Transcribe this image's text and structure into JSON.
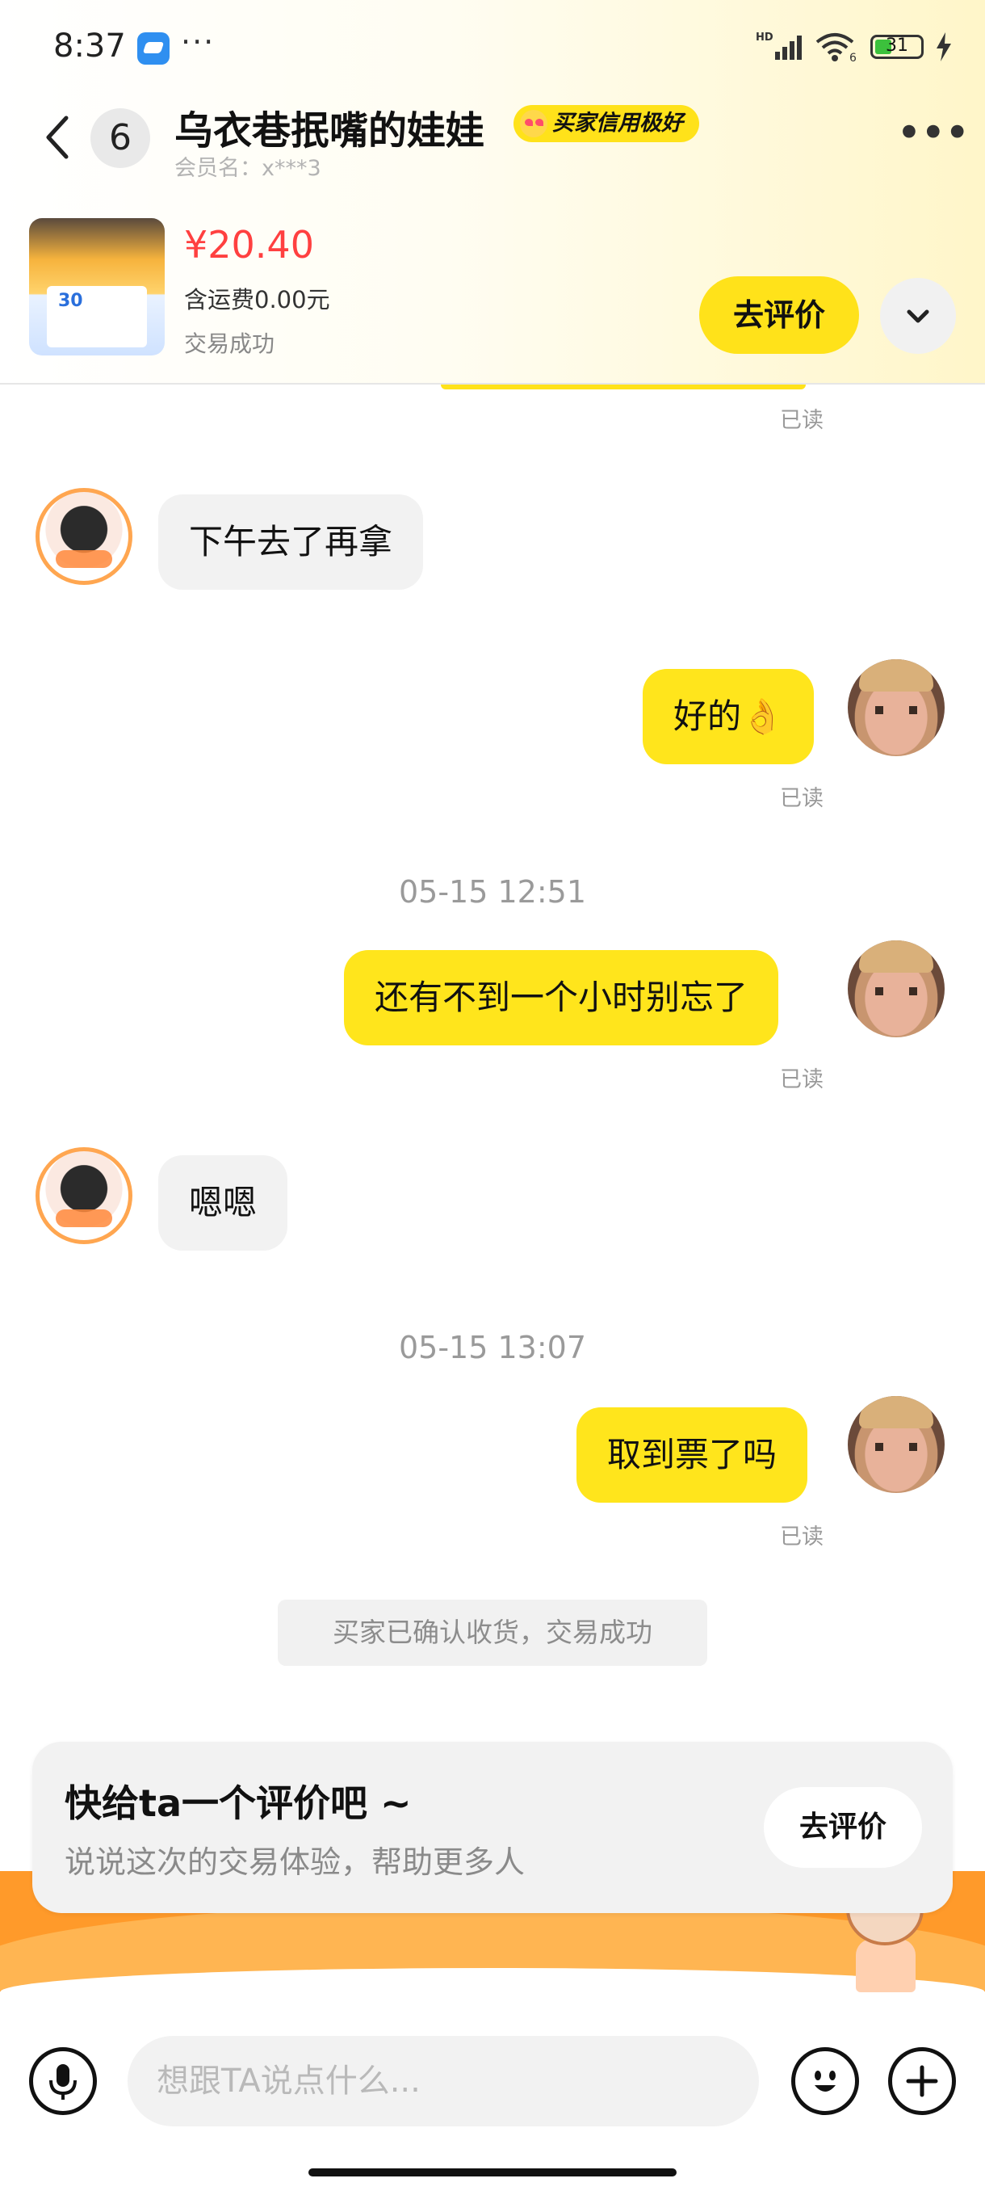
{
  "status_bar": {
    "time": "8:37",
    "dots": "···",
    "network_label": "HD",
    "wifi_label": "6",
    "battery": "31"
  },
  "header": {
    "unread_count": "6",
    "title": "乌衣巷抿嘴的娃娃",
    "credit_badge": "买家信用极好",
    "member_name": "会员名：x***3"
  },
  "product": {
    "price": "¥20.40",
    "shipping": "含运费0.00元",
    "status": "交易成功",
    "review_button": "去评价"
  },
  "messages": {
    "read_label": "已读",
    "m1": "下午去了再拿",
    "m2": "好的👌",
    "t1": "05-15 12:51",
    "m3": "还有不到一个小时别忘了",
    "m4": "嗯嗯",
    "t2": "05-15 13:07",
    "m5": "取到票了吗",
    "system": "买家已确认收货，交易成功"
  },
  "review_card": {
    "title": "快给ta一个评价吧 ~",
    "subtitle": "说说这次的交易体验，帮助更多人",
    "button": "去评价"
  },
  "input": {
    "placeholder": "想跟TA说点什么..."
  },
  "icons": [
    "back-icon",
    "more-icon",
    "chevron-down-icon",
    "mic-icon",
    "emoji-icon",
    "plus-icon",
    "signal-icon",
    "wifi-icon",
    "battery-icon",
    "charging-icon"
  ],
  "colors": {
    "accent_yellow": "#ffe51c",
    "price_red": "#ff4040",
    "muted_gray": "#9a9a9a"
  }
}
